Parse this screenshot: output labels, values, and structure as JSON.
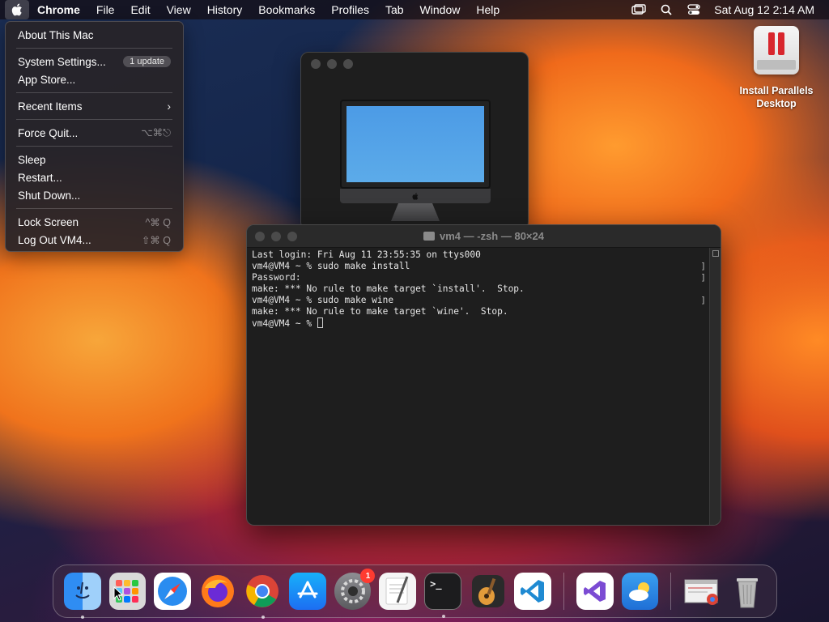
{
  "menubar": {
    "app_name": "Chrome",
    "menus": [
      "File",
      "Edit",
      "View",
      "History",
      "Bookmarks",
      "Profiles",
      "Tab",
      "Window",
      "Help"
    ],
    "clock": "Sat Aug 12  2:14 AM"
  },
  "apple_menu": {
    "about": "About This Mac",
    "system_settings": "System Settings...",
    "update_badge": "1 update",
    "app_store": "App Store...",
    "recent_items": "Recent Items",
    "force_quit": "Force Quit...",
    "force_quit_shortcut": "⌥⌘⎋",
    "sleep": "Sleep",
    "restart": "Restart...",
    "shut_down": "Shut Down...",
    "lock_screen": "Lock Screen",
    "lock_screen_shortcut": "^⌘ Q",
    "log_out": "Log Out VM4...",
    "log_out_shortcut": "⇧⌘ Q"
  },
  "desktop_icon": {
    "label_line1": "Install Parallels",
    "label_line2": "Desktop"
  },
  "terminal": {
    "title": "vm4 — -zsh — 80×24",
    "lines": [
      "Last login: Fri Aug 11 23:55:35 on ttys000",
      "vm4@VM4 ~ % sudo make install",
      "Password:",
      "make: *** No rule to make target `install'.  Stop.",
      "vm4@VM4 ~ % sudo make wine",
      "make: *** No rule to make target `wine'.  Stop."
    ],
    "prompt": "vm4@VM4 ~ % "
  },
  "dock": {
    "settings_badge": "1",
    "terminal_glyph": ">_"
  },
  "colors": {
    "menu_bg": "#28242a",
    "badge_red": "#ff3b30",
    "terminal_bg": "#1e1e1e"
  }
}
